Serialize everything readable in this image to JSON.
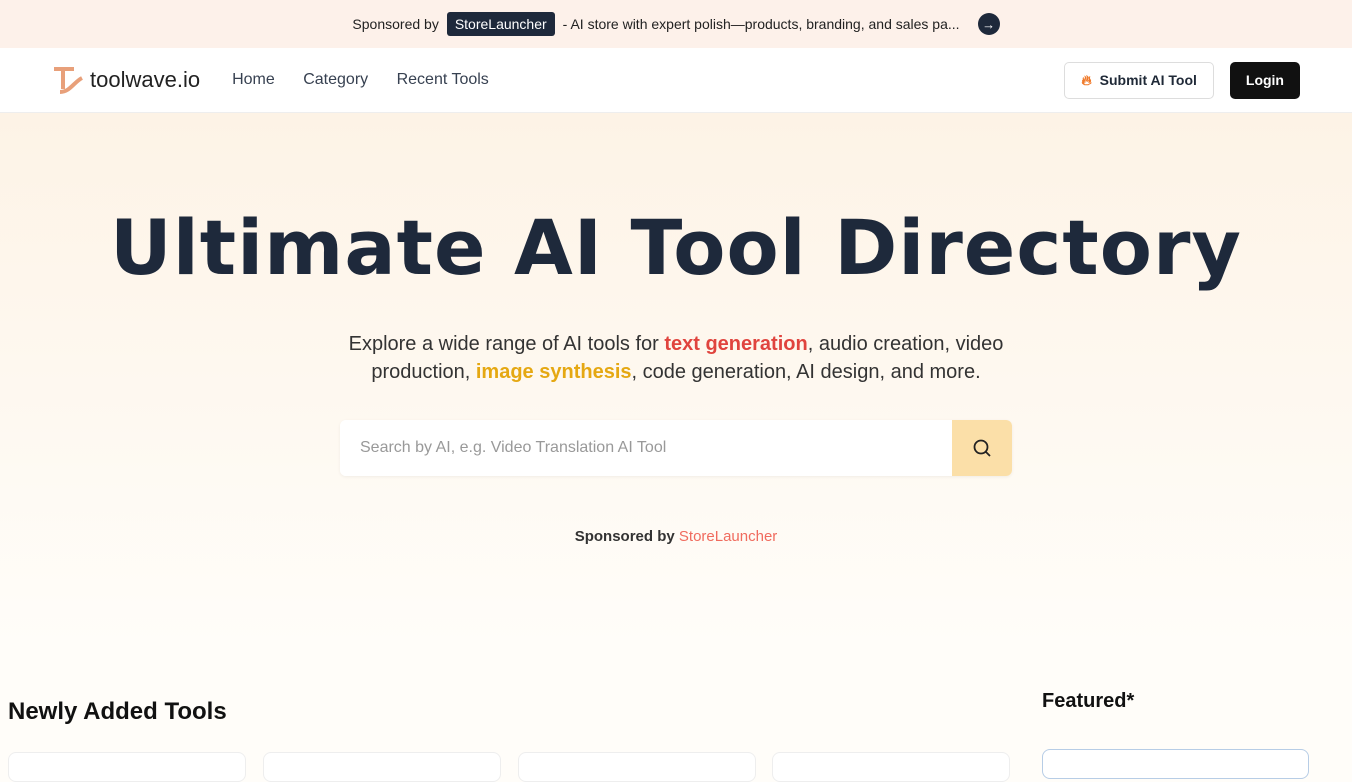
{
  "banner": {
    "prefix": "Sponsored by",
    "sponsor": "StoreLauncher",
    "text": "- AI store with expert polish—products, branding, and sales pa..."
  },
  "nav": {
    "logo": "toolwave.io",
    "links": [
      "Home",
      "Category",
      "Recent Tools"
    ],
    "submit": "Submit AI Tool",
    "login": "Login"
  },
  "hero": {
    "title": "Ultimate AI Tool Directory",
    "sub_1": "Explore a wide range of AI tools for ",
    "hl_1": "text generation",
    "sub_2": ", audio creation, video production, ",
    "hl_2": "image synthesis",
    "sub_3": ", code generation, AI design, and more.",
    "search_placeholder": "Search by AI, e.g. Video Translation AI Tool",
    "sponsored_prefix": "Sponsored by",
    "sponsored_name": "StoreLauncher"
  },
  "sections": {
    "newly": "Newly Added Tools",
    "featured": "Featured*"
  }
}
